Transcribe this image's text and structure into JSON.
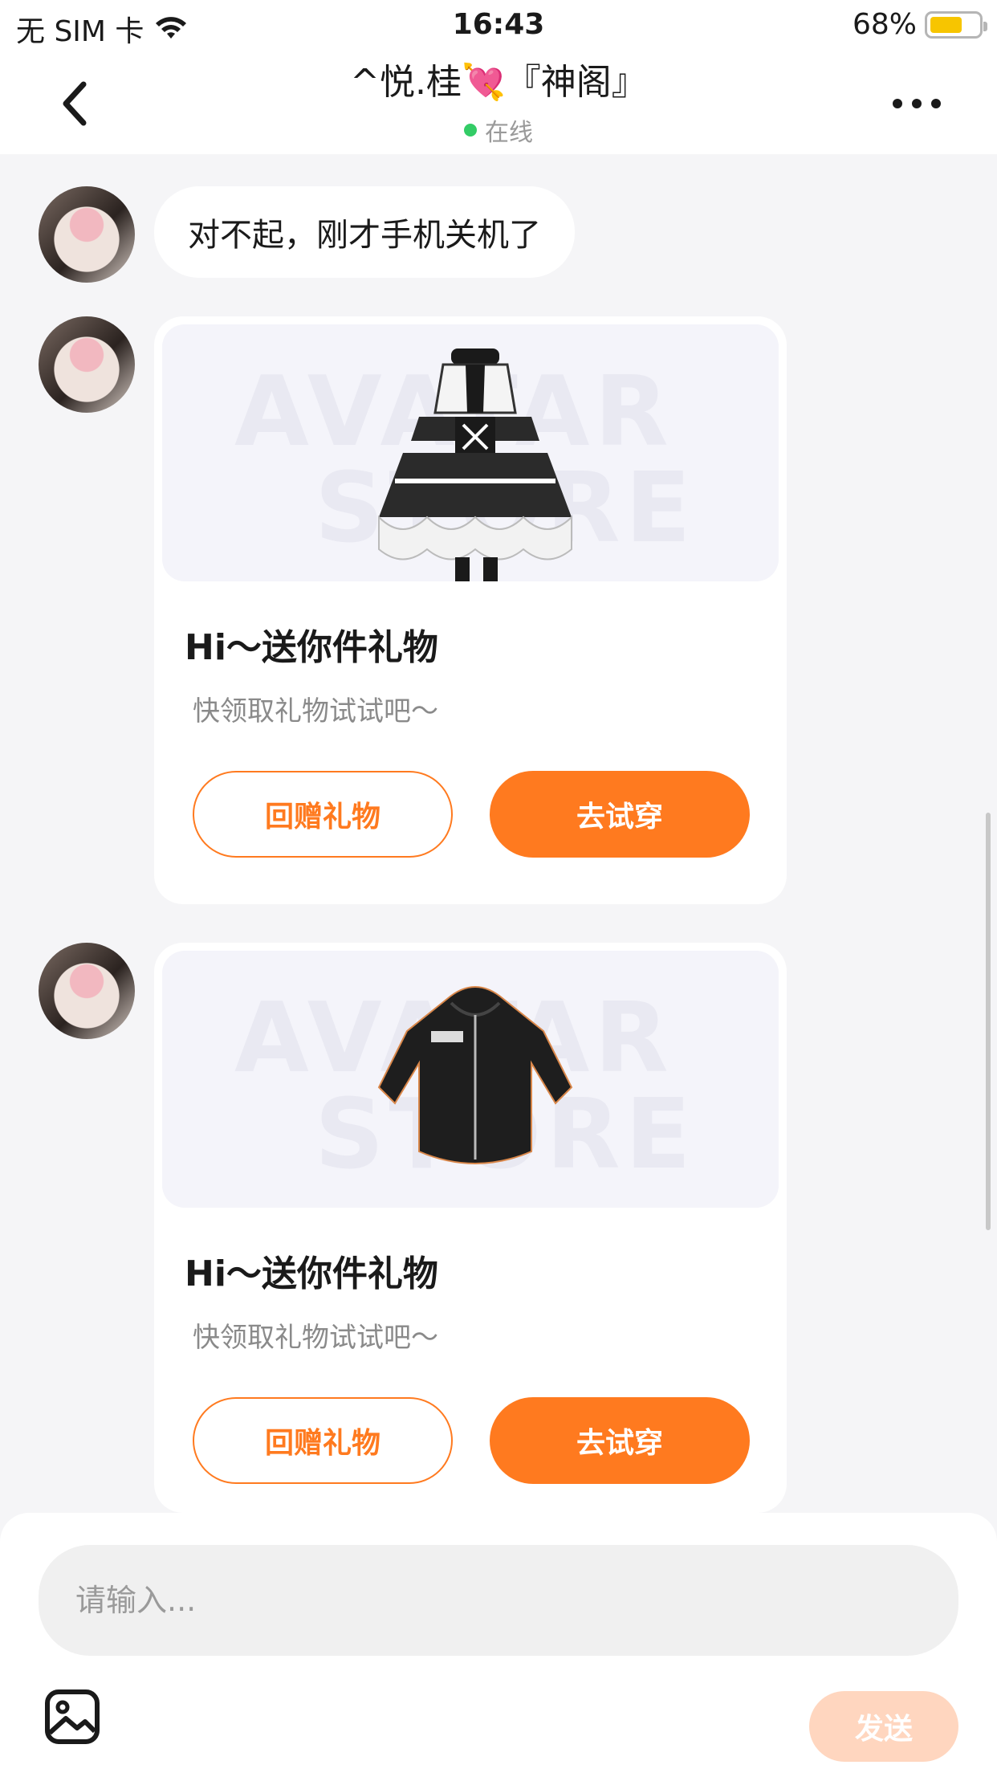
{
  "status_bar": {
    "carrier": "无 SIM 卡",
    "time": "16:43",
    "battery_percent": "68%",
    "battery_level": 0.68
  },
  "header": {
    "title": "^悦.桂💘『神阁』",
    "online_status": "在线",
    "back_icon": "chevron-left-icon",
    "more_icon": "ellipsis-icon"
  },
  "messages": [
    {
      "type": "text",
      "text": "对不起，刚才手机关机了"
    },
    {
      "type": "gift",
      "image": "maid-dress",
      "watermark": [
        "AVATAR",
        "STORE"
      ],
      "title": "Hi～送你件礼物",
      "subtitle": "快领取礼物试试吧～",
      "return_gift_label": "回赠礼物",
      "try_on_label": "去试穿"
    },
    {
      "type": "gift",
      "image": "black-hoodie",
      "watermark": [
        "AVATAR",
        "STORE"
      ],
      "title": "Hi～送你件礼物",
      "subtitle": "快领取礼物试试吧～",
      "return_gift_label": "回赠礼物",
      "try_on_label": "去试穿"
    }
  ],
  "composer": {
    "placeholder": "请输入...",
    "value": "",
    "image_icon": "image-icon",
    "send_label": "发送"
  },
  "colors": {
    "accent": "#ff7a1f",
    "send_disabled": "#ffd6bf",
    "online": "#33cc66",
    "battery": "#f7c500"
  }
}
